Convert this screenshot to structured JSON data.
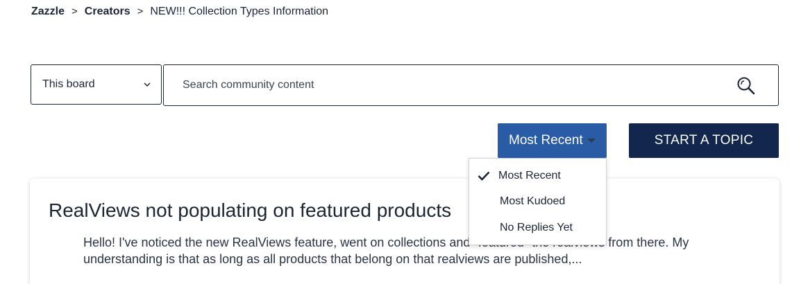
{
  "breadcrumb": {
    "items": [
      "Zazzle",
      "Creators"
    ],
    "current": "NEW!!! Collection Types Information"
  },
  "search": {
    "scope": "This board",
    "placeholder": "Search community content"
  },
  "toolbar": {
    "sort_label": "Most Recent",
    "start_topic_label": "START A TOPIC"
  },
  "sort_menu": {
    "options": [
      "Most Recent",
      "Most Kudoed",
      "No Replies Yet"
    ],
    "selected": "Most Recent"
  },
  "topics": [
    {
      "title": "RealViews not populating on featured products",
      "body": "Hello! I've noticed the new RealViews feature, went on collections and \"featured\" the realviews from there. My understanding is that as long as all products that belong on that realviews are published,..."
    }
  ],
  "colors": {
    "sort_button": "#2a5ba5",
    "start_topic_button": "#13264d",
    "text": "#1a2433"
  }
}
